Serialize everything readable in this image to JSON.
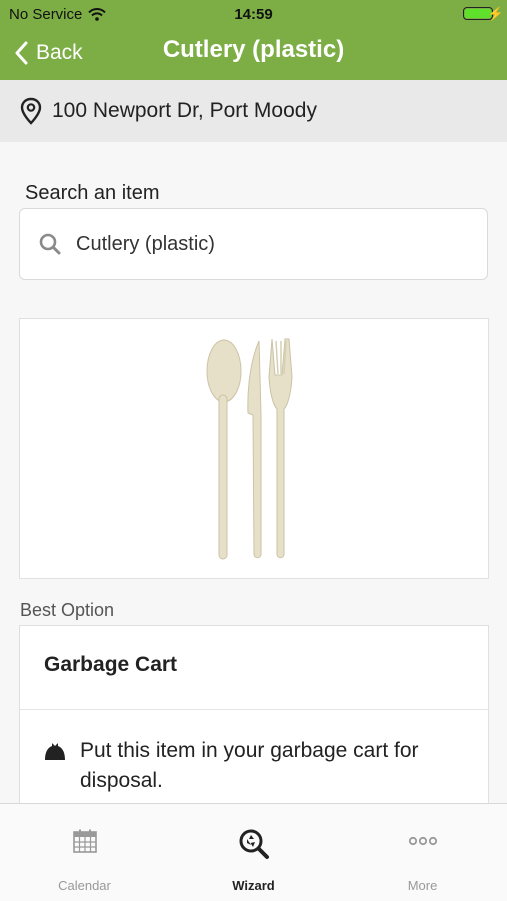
{
  "status_bar": {
    "carrier": "No Service",
    "time": "14:59"
  },
  "header": {
    "back_label": "Back",
    "title": "Cutlery (plastic)"
  },
  "location": {
    "address": "100 Newport Dr, Port Moody"
  },
  "search": {
    "label": "Search an item",
    "value": "Cutlery (plastic)"
  },
  "best_option": {
    "section_label": "Best Option",
    "title": "Garbage Cart",
    "instruction": "Put this item in your garbage cart for disposal."
  },
  "tabs": [
    {
      "label": "Calendar",
      "icon": "calendar-icon",
      "active": false
    },
    {
      "label": "Wizard",
      "icon": "wizard-icon",
      "active": true
    },
    {
      "label": "More",
      "icon": "more-icon",
      "active": false
    }
  ],
  "colors": {
    "brand_green": "#7cae45",
    "battery_green": "#5fe02a"
  }
}
